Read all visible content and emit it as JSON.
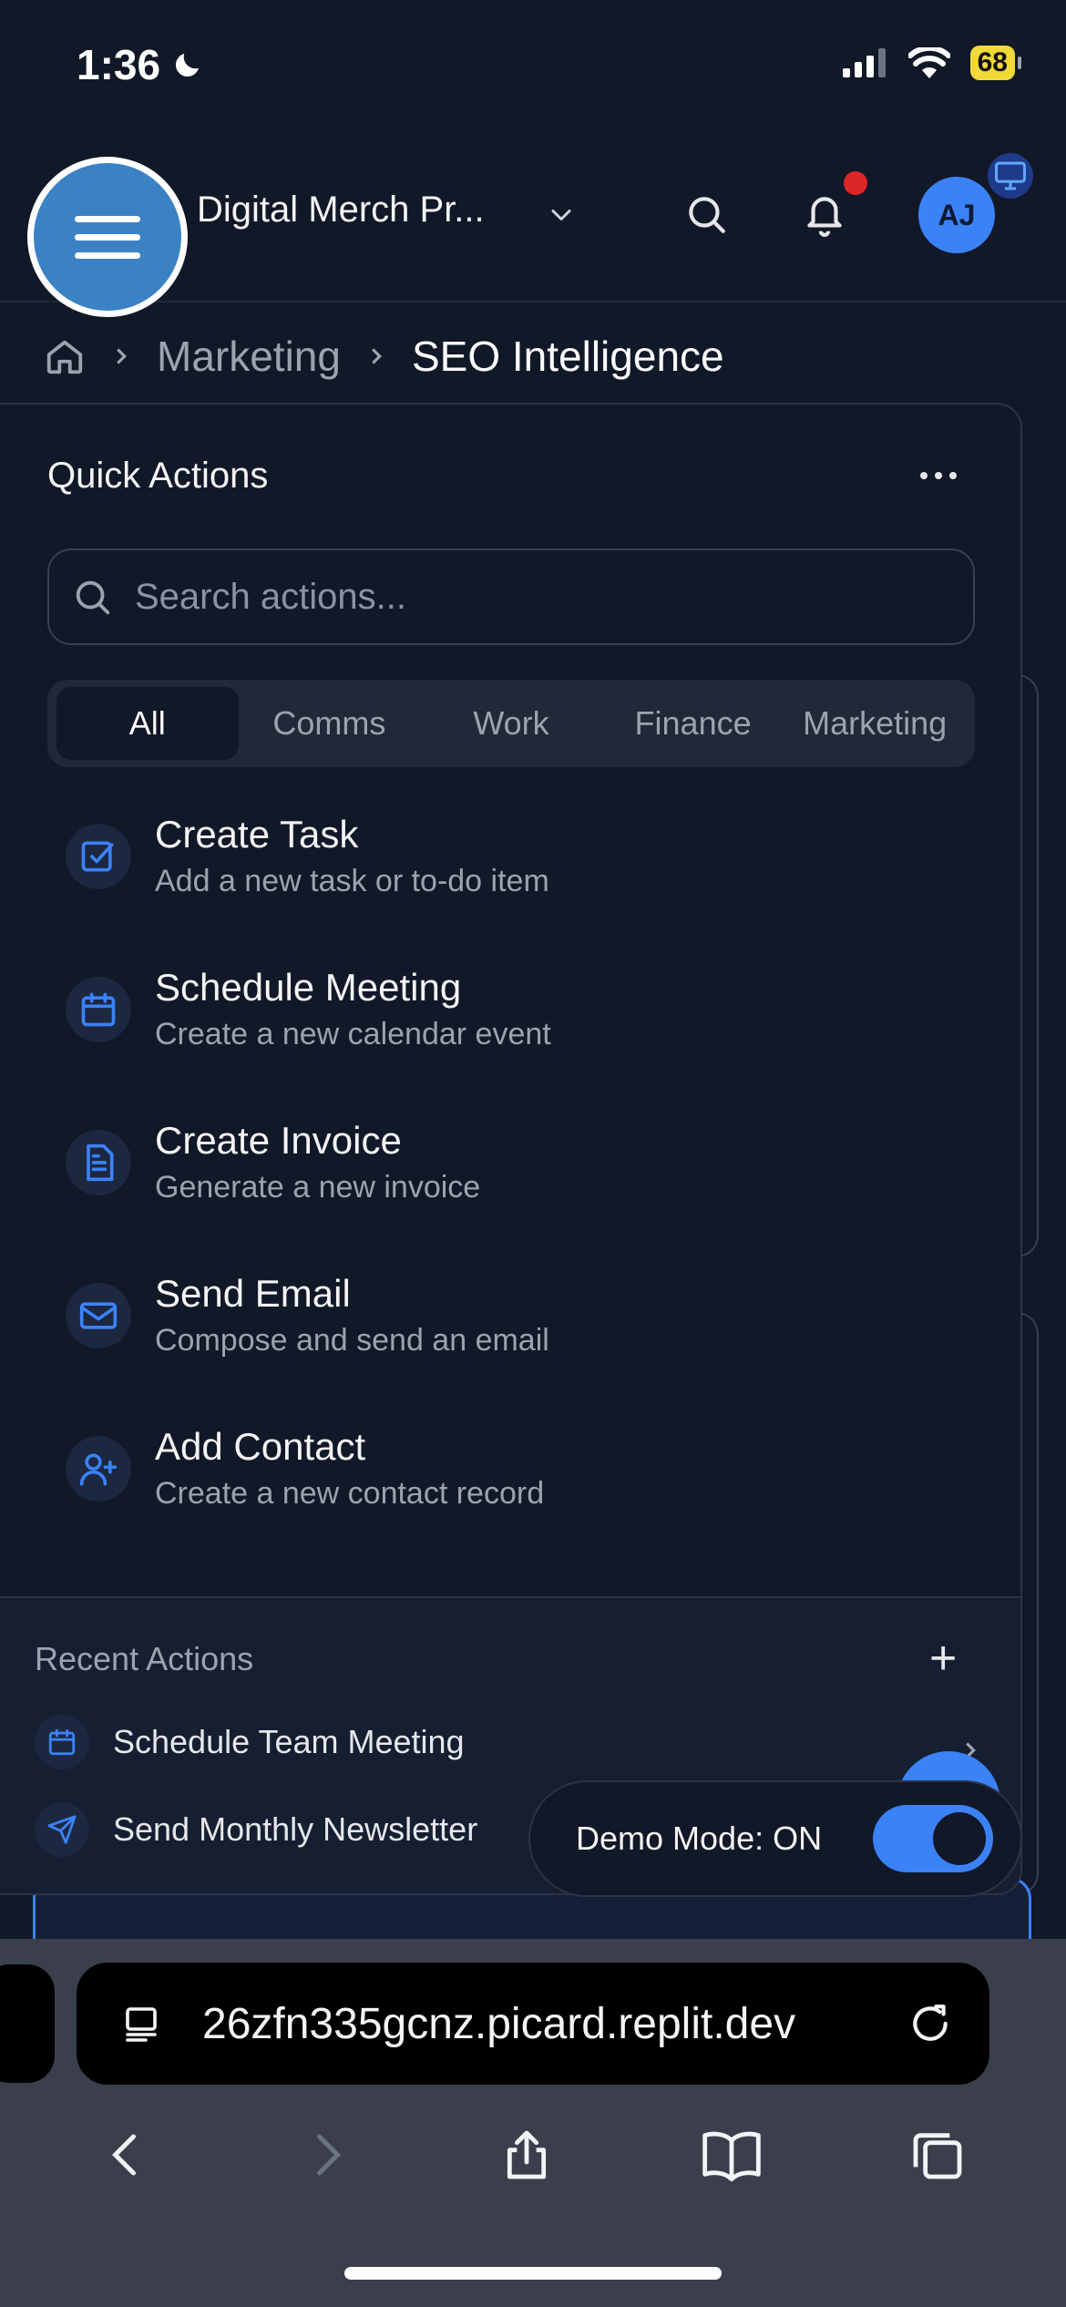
{
  "status_bar": {
    "time": "1:36",
    "battery": "68"
  },
  "header": {
    "org_name": "Digital Merch Pr...",
    "avatar_initials": "AJ"
  },
  "breadcrumb": {
    "items": [
      "Marketing",
      "SEO Intelligence"
    ]
  },
  "quick_actions": {
    "title": "Quick Actions",
    "search_placeholder": "Search actions...",
    "tabs": [
      "All",
      "Comms",
      "Work",
      "Finance",
      "Marketing"
    ],
    "active_tab": "All",
    "actions": [
      {
        "icon": "checkbox-icon",
        "title": "Create Task",
        "description": "Add a new task or to-do item"
      },
      {
        "icon": "calendar-icon",
        "title": "Schedule Meeting",
        "description": "Create a new calendar event"
      },
      {
        "icon": "document-icon",
        "title": "Create Invoice",
        "description": "Generate a new invoice"
      },
      {
        "icon": "mail-icon",
        "title": "Send Email",
        "description": "Compose and send an email"
      },
      {
        "icon": "user-plus-icon",
        "title": "Add Contact",
        "description": "Create a new contact record"
      }
    ]
  },
  "recent_actions": {
    "title": "Recent Actions",
    "items": [
      {
        "icon": "calendar-icon",
        "label": "Schedule Team Meeting"
      },
      {
        "icon": "send-icon",
        "label": "Send Monthly Newsletter"
      }
    ]
  },
  "demo_mode": {
    "label": "Demo Mode: ON",
    "enabled": true
  },
  "browser": {
    "url": "26zfn335gcnz.picard.replit.dev"
  },
  "colors": {
    "accent": "#3b82f6",
    "background": "#111827",
    "menu_button": "#3b82c4",
    "notification_dot": "#dc2626",
    "battery": "#f2d93a"
  }
}
